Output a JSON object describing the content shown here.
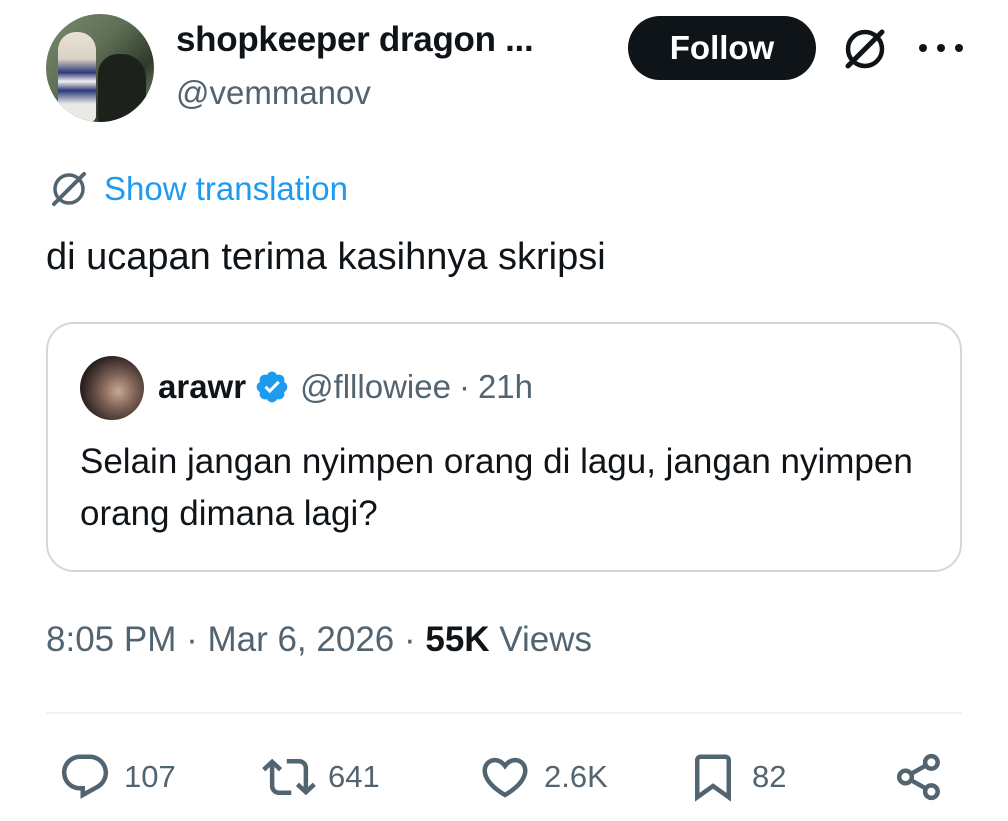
{
  "author": {
    "name": "shopkeeper dragon ...",
    "handle": "@vemmanov"
  },
  "follow_label": "Follow",
  "translate_label": "Show translation",
  "tweet_text": "di ucapan terima kasihnya skripsi",
  "quote": {
    "name": "arawr",
    "handle": "@flllowiee",
    "separator": "·",
    "time": "21h",
    "text": "Selain jangan nyimpen orang di lagu, jangan nyimpen orang dimana lagi?"
  },
  "meta": {
    "time": "8:05 PM",
    "sep1": " · ",
    "date": "Mar 6, 2026",
    "sep2": " · ",
    "views_count": "55K",
    "views_label": " Views"
  },
  "actions": {
    "replies": "107",
    "reposts": "641",
    "likes": "2.6K",
    "bookmarks": "82"
  },
  "icons": {
    "grok": "grok-icon",
    "more": "more-icon",
    "translate": "translate-icon",
    "verified": "verified-badge-icon",
    "reply": "reply-icon",
    "repost": "repost-icon",
    "like": "heart-icon",
    "bookmark": "bookmark-icon",
    "share": "share-icon"
  },
  "colors": {
    "link": "#1d9bf0",
    "secondary_text": "#536471",
    "primary_text": "#0f1419",
    "follow_bg": "#0f1419",
    "verified": "#1d9bf0"
  }
}
